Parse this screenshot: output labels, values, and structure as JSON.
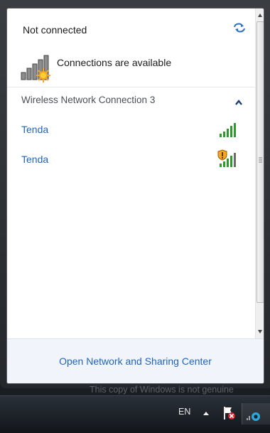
{
  "flyout": {
    "status_title": "Not connected",
    "connection_status": "Connections are available",
    "section_header": "Wireless Network Connection 3",
    "networks": [
      {
        "name": "Tenda",
        "secured": false
      },
      {
        "name": "Tenda",
        "secured": true
      }
    ],
    "footer_link": "Open Network and Sharing Center"
  },
  "desktop": {
    "watermark": "This copy of Windows is not genuine"
  },
  "taskbar": {
    "language": "EN"
  },
  "colors": {
    "link": "#1f64b8",
    "signal_green": "#2f9a2c",
    "warning_amber": "#f5a623"
  },
  "icons": [
    "refresh-icon",
    "no-internet-signal-icon",
    "collapse-chevron-icon",
    "signal-strength-icon",
    "security-shield-icon",
    "action-center-flag-icon",
    "network-tray-icon"
  ]
}
